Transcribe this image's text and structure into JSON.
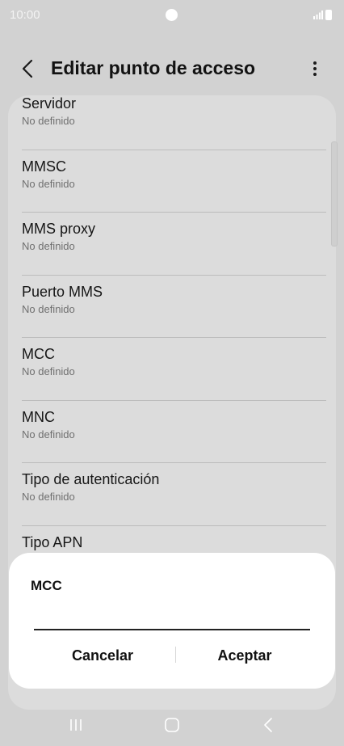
{
  "status_bar": {
    "time": "10:00"
  },
  "header": {
    "title": "Editar punto de acceso"
  },
  "settings": {
    "items": [
      {
        "label": "Servidor",
        "value": "No definido"
      },
      {
        "label": "MMSC",
        "value": "No definido"
      },
      {
        "label": "MMS proxy",
        "value": "No definido"
      },
      {
        "label": "Puerto MMS",
        "value": "No definido"
      },
      {
        "label": "MCC",
        "value": "No definido"
      },
      {
        "label": "MNC",
        "value": "No definido"
      },
      {
        "label": "Tipo de autenticación",
        "value": "No definido"
      },
      {
        "label": "Tipo APN",
        "value": ""
      }
    ]
  },
  "dialog": {
    "title": "MCC",
    "input_value": "",
    "cancel_label": "Cancelar",
    "accept_label": "Aceptar"
  },
  "icons": {
    "back": "back-arrow-icon",
    "more": "more-vertical-icon",
    "signal": "signal-icon",
    "battery": "battery-icon",
    "nav_recents": "recents-icon",
    "nav_home": "home-icon",
    "nav_back": "nav-back-icon"
  },
  "colors": {
    "background": "#d2d2d2",
    "card": "#dcdcdc",
    "dialog": "#ffffff",
    "status_text": "#f3f3f3"
  }
}
